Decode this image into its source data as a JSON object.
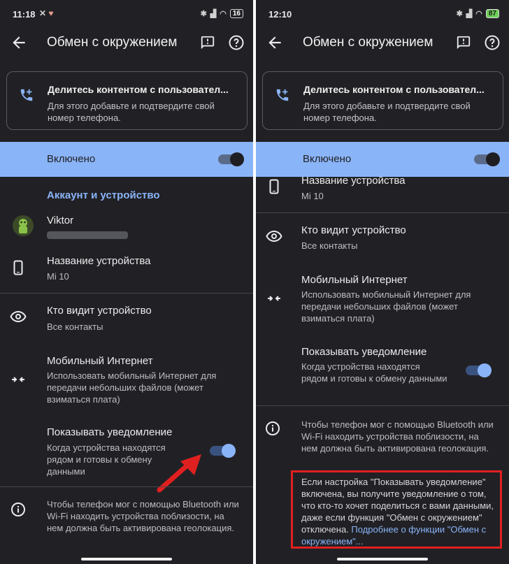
{
  "left": {
    "status": {
      "time": "11:18",
      "battery": "16"
    },
    "header": {
      "title": "Обмен с окружением"
    },
    "card": {
      "title": "Делитесь контентом с пользовател...",
      "subtitle": "Для этого добавьте и подтвердите свой номер телефона."
    },
    "enabled": {
      "label": "Включено",
      "on": true
    },
    "section_title": "Аккаунт и устройство",
    "account": {
      "name": "Viktor"
    },
    "device_name": {
      "label": "Название устройства",
      "value": "Mi 10"
    },
    "visibility": {
      "label": "Кто видит устройство",
      "value": "Все контакты"
    },
    "mobile_data": {
      "label": "Мобильный Интернет",
      "value": "Использовать мобильный Интернет для передачи небольших файлов (может взиматься плата)"
    },
    "notifications": {
      "label": "Показывать уведомление",
      "value": "Когда устройства находятся рядом и готовы к обмену данными",
      "on": true
    },
    "info": "Чтобы телефон мог с помощью Bluetooth или Wi-Fi находить устройства поблизости, на нем должна быть активирована геолокация."
  },
  "right": {
    "status": {
      "time": "12:10",
      "battery": "87"
    },
    "header": {
      "title": "Обмен с окружением"
    },
    "card": {
      "title": "Делитесь контентом с пользовател...",
      "subtitle": "Для этого добавьте и подтвердите свой номер телефона."
    },
    "enabled": {
      "label": "Включено",
      "on": true
    },
    "device_name": {
      "label": "Название устройства",
      "value": "Mi 10"
    },
    "visibility": {
      "label": "Кто видит устройство",
      "value": "Все контакты"
    },
    "mobile_data": {
      "label": "Мобильный Интернет",
      "value": "Использовать мобильный Интернет для передачи небольших файлов (может взиматься плата)"
    },
    "notifications": {
      "label": "Показывать уведомление",
      "value": "Когда устройства находятся рядом и готовы к обмену данными",
      "on": true
    },
    "info": "Чтобы телефон мог с помощью Bluetooth или Wi-Fi находить устройства поблизости, на нем должна быть активирована геолокация.",
    "note": "Если настройка \"Показывать уведомление\" включена, вы получите уведомление о том, что кто-то хочет поделиться с вами данными, даже если функция \"Обмен с окружением\" отключена. ",
    "note_link": "Подробнее о функции \"Обмен с окружением\"..."
  },
  "colors": {
    "background": "#212125",
    "accent": "#8ab4f8",
    "highlight": "#e02020"
  }
}
